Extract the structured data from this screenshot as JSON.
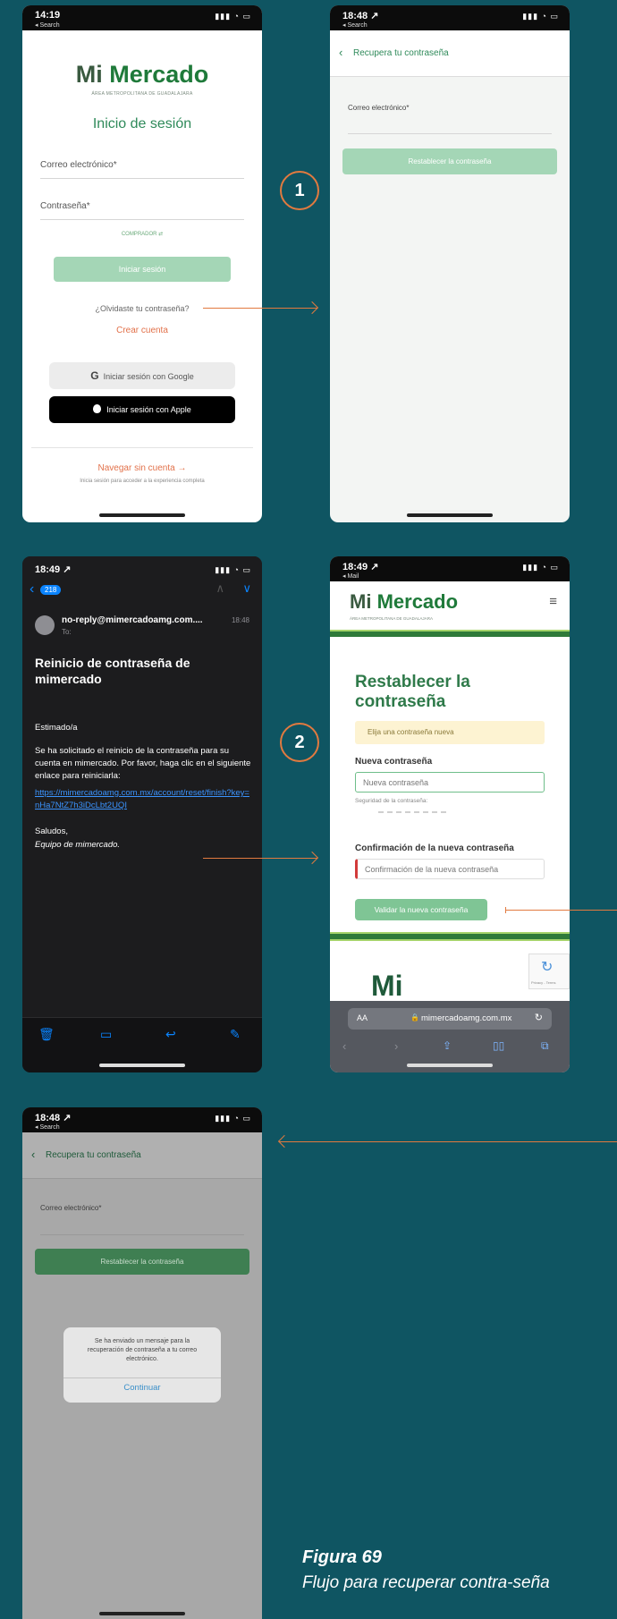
{
  "steps": {
    "one": "1",
    "two": "2"
  },
  "screen1": {
    "time": "14:19",
    "back_app": "◂ Search",
    "status_icons": "▮▮▮ ◔ ▭",
    "logo_mi": "Mi",
    "logo_mercado": "Mercado",
    "logo_sub": "ÁREA METROPOLITANA DE GUADALAJARA",
    "title": "Inicio de sesión",
    "email_label": "Correo electrónico*",
    "password_label": "Contraseña*",
    "comprador": "COMPRADOR ⇄",
    "login_button": "Iniciar sesión",
    "forgot_link": "¿Olvidaste tu contraseña?",
    "create_account": "Crear cuenta",
    "google_button": "Iniciar sesión con Google",
    "apple_button": "Iniciar sesión con Apple",
    "guest_link": "Navegar sin cuenta →",
    "guest_sub": "Inicia sesión para acceder a la experiencia completa"
  },
  "screen2": {
    "time": "18:48 ↗",
    "back_app": "◂ Search",
    "status_icons": "▮▮▮ ◔ ▭",
    "header_title": "Recupera tu contraseña",
    "email_label": "Correo electrónico*",
    "reset_button": "Restablecer la contraseña"
  },
  "screen3": {
    "time": "18:49 ↗",
    "status_icons": "▮▮▮ ◔ ▭",
    "badge": "218",
    "sender": "no-reply@mimercadoamg.com....",
    "sent_time": "18:48",
    "to": "To:",
    "subject": "Reinicio de contraseña de mimercado",
    "greeting": "Estimado/a",
    "body": "Se ha solicitado el reinicio de la contraseña para su cuenta en mimercado. Por favor, haga clic en el siguiente enlace para reiniciarla:",
    "link": "https://mimercadoamg.com.mx/account/reset/finish?key=nHa7NtZ7h3iDcLbt2UQI",
    "closing": "Saludos,",
    "signature": "Equipo de mimercado."
  },
  "screen4": {
    "time": "18:49 ↗",
    "back_app": "◂ Mail",
    "status_icons": "▮▮▮ ◔ ▭",
    "logo_mi": "Mi",
    "logo_mercado": "Mercado",
    "logo_sub": "ÁREA METROPOLITANA DE GUADALAJARA",
    "title": "Restablecer la contraseña",
    "notice": "Elija una contraseña nueva",
    "new_password_label": "Nueva contraseña",
    "new_password_placeholder": "Nueva contraseña",
    "strength_label": "Seguridad de la contraseña:",
    "confirm_label": "Confirmación de la nueva contraseña",
    "confirm_placeholder": "Confirmación de la nueva contraseña",
    "validate_button": "Validar la nueva contraseña",
    "recaptcha": "Privacy - Terms",
    "url_aa": "AA",
    "url": "mimercadoamg.com.mx"
  },
  "screen5": {
    "time": "18:48 ↗",
    "back_app": "◂ Search",
    "status_icons": "▮▮▮ ◔ ▭",
    "header_title": "Recupera tu contraseña",
    "email_label": "Correo electrónico*",
    "reset_button": "Restablecer la contraseña",
    "dialog_message": "Se ha enviado un mensaje para la recuperación de contraseña a tu correo electrónico.",
    "dialog_button": "Continuar"
  },
  "caption": {
    "title": "Figura 69",
    "text": "Flujo para recuperar contra-seña"
  }
}
